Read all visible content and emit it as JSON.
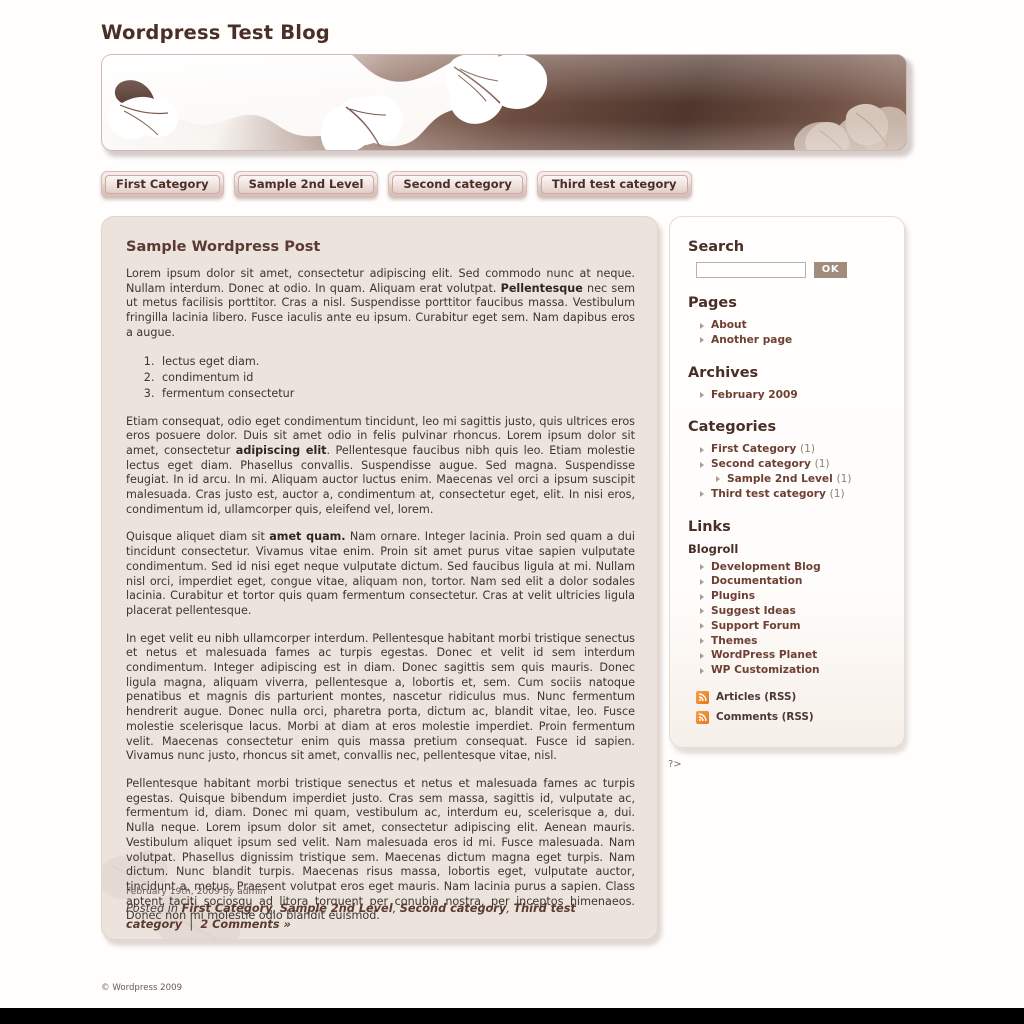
{
  "blog": {
    "title": "Wordpress Test Blog"
  },
  "nav": {
    "items": [
      {
        "label": "First Category"
      },
      {
        "label": "Sample 2nd Level"
      },
      {
        "label": "Second category"
      },
      {
        "label": "Third test category"
      }
    ]
  },
  "post": {
    "title": "Sample Wordpress Post",
    "paragraph1_a": "Lorem ipsum dolor sit amet, consectetur adipiscing elit. Sed commodo nunc at neque. Nullam interdum. Donec at odio. In quam. Aliquam erat volutpat. ",
    "paragraph1_bold": "Pellentesque",
    "paragraph1_b": " nec sem ut metus facilisis porttitor. Cras a nisl. Suspendisse porttitor faucibus massa. Vestibulum fringilla lacinia libero. Fusce iaculis ante eu ipsum. Curabitur eget sem. Nam dapibus eros a augue.",
    "list": [
      "lectus eget diam.",
      "condimentum id",
      "fermentum consectetur"
    ],
    "paragraph2_a": "Etiam consequat, odio eget condimentum tincidunt, leo mi sagittis justo, quis ultrices eros eros posuere dolor. Duis sit amet odio in felis pulvinar rhoncus. Lorem ipsum dolor sit amet, consectetur ",
    "paragraph2_bold": "adipiscing elit",
    "paragraph2_b": ". Pellentesque faucibus nibh quis leo. Etiam molestie lectus eget diam. Phasellus convallis. Suspendisse augue. Sed magna. Suspendisse feugiat. In id arcu. In mi. Aliquam auctor luctus enim. Maecenas vel orci a ipsum suscipit malesuada. Cras justo est, auctor a, condimentum at, consectetur eget, elit. In nisi eros, condimentum id, ullamcorper quis, eleifend vel, lorem.",
    "paragraph3_a": "Quisque aliquet diam sit ",
    "paragraph3_bold": "amet quam.",
    "paragraph3_b": " Nam ornare. Integer lacinia. Proin sed quam a dui tincidunt consectetur. Vivamus vitae enim. Proin sit amet purus vitae sapien vulputate condimentum. Sed id nisi eget neque vulputate dictum. Sed faucibus ligula at mi. Nullam nisl orci, imperdiet eget, congue vitae, aliquam non, tortor. Nam sed elit a dolor sodales lacinia. Curabitur et tortor quis quam fermentum consectetur. Cras at velit ultricies ligula placerat pellentesque.",
    "paragraph4": "In eget velit eu nibh ullamcorper interdum. Pellentesque habitant morbi tristique senectus et netus et malesuada fames ac turpis egestas. Donec et velit id sem interdum condimentum. Integer adipiscing est in diam. Donec sagittis sem quis mauris. Donec ligula magna, aliquam viverra, pellentesque a, lobortis et, sem. Cum sociis natoque penatibus et magnis dis parturient montes, nascetur ridiculus mus. Nunc fermentum hendrerit augue. Donec nulla orci, pharetra porta, dictum ac, blandit vitae, leo. Fusce molestie scelerisque lacus. Morbi at diam at eros molestie imperdiet. Proin fermentum velit. Maecenas consectetur enim quis massa pretium consequat. Fusce id sapien. Vivamus nunc justo, rhoncus sit amet, convallis nec, pellentesque vitae, nisl.",
    "paragraph5": "Pellentesque habitant morbi tristique senectus et netus et malesuada fames ac turpis egestas. Quisque bibendum imperdiet justo. Cras sem massa, sagittis id, vulputate ac, fermentum id, diam. Donec mi quam, vestibulum ac, interdum eu, scelerisque a, dui. Nulla neque. Lorem ipsum dolor sit amet, consectetur adipiscing elit. Aenean mauris. Vestibulum aliquet ipsum sed velit. Nam malesuada eros id mi. Fusce malesuada. Nam volutpat. Phasellus dignissim tristique sem. Maecenas dictum magna eget turpis. Nam dictum. Nunc blandit turpis. Maecenas risus massa, lobortis eget, vulputate auctor, tincidunt a, metus. Praesent volutpat eros eget mauris. Nam lacinia purus a sapien. Class aptent taciti sociosqu ad litora torquent per conubia nostra, per inceptos himenaeos. Donec non mi molestie odio blandit euismod.",
    "meta": "February 19th, 2009 by admin",
    "footer_prefix": "Posted in ",
    "footer_categories": [
      "First Category",
      "Sample 2nd Level",
      "Second category",
      "Third test category"
    ],
    "footer_comments": "2 Comments »"
  },
  "sidebar": {
    "search": {
      "heading": "Search",
      "value": "",
      "placeholder": "",
      "button_label": "OK"
    },
    "pages": {
      "heading": "Pages",
      "items": [
        {
          "label": "About"
        },
        {
          "label": "Another page"
        }
      ]
    },
    "archives": {
      "heading": "Archives",
      "items": [
        {
          "label": "February 2009"
        }
      ]
    },
    "categories": {
      "heading": "Categories",
      "items": [
        {
          "label": "First Category",
          "count": "(1)",
          "nested": false
        },
        {
          "label": "Second category",
          "count": "(1)",
          "nested": false
        },
        {
          "label": "Sample 2nd Level",
          "count": "(1)",
          "nested": true
        },
        {
          "label": "Third test category",
          "count": "(1)",
          "nested": false
        }
      ]
    },
    "links": {
      "heading": "Links",
      "subheading": "Blogroll",
      "items": [
        {
          "label": "Development Blog"
        },
        {
          "label": "Documentation"
        },
        {
          "label": "Plugins"
        },
        {
          "label": "Suggest Ideas"
        },
        {
          "label": "Support Forum"
        },
        {
          "label": "Themes"
        },
        {
          "label": "WordPress Planet"
        },
        {
          "label": "WP Customization"
        }
      ]
    },
    "feeds": [
      {
        "label": "Articles (RSS)"
      },
      {
        "label": "Comments (RSS)"
      }
    ]
  },
  "artifact": "?>",
  "footer": {
    "copyright": "© Wordpress 2009"
  },
  "colors": {
    "accent": "#5b3a31",
    "banner_dark": "#4f362c",
    "panel": "#ece3dd",
    "sidebar": "#fffefd",
    "link": "#6e4034",
    "rss_orange": "#e8761b",
    "ok_button": "#a08b7d"
  }
}
